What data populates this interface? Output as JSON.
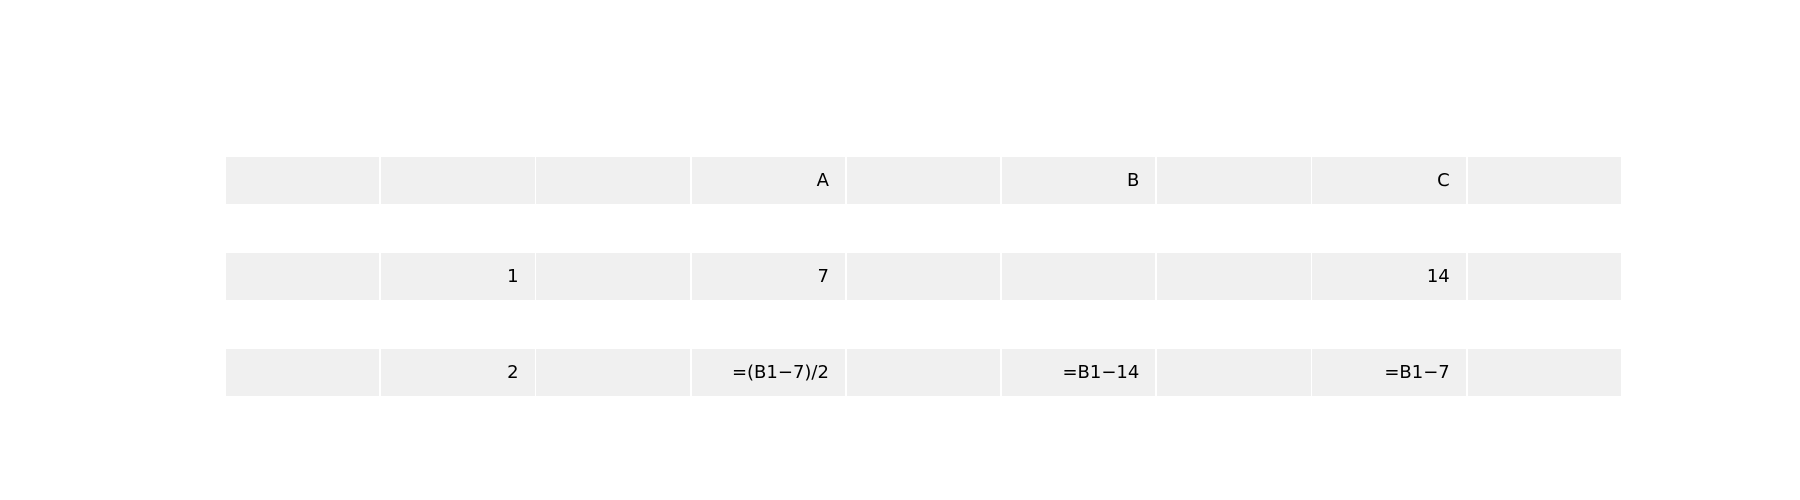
{
  "rows": [
    [
      "",
      "",
      "",
      "A",
      "",
      "B",
      "",
      "C",
      ""
    ],
    [
      "",
      "1",
      "",
      "7",
      "",
      "",
      "",
      "14",
      ""
    ],
    [
      "",
      "2",
      "",
      "=(B1−7)/2",
      "",
      "=B1−14",
      "",
      "=B1−7",
      ""
    ]
  ]
}
